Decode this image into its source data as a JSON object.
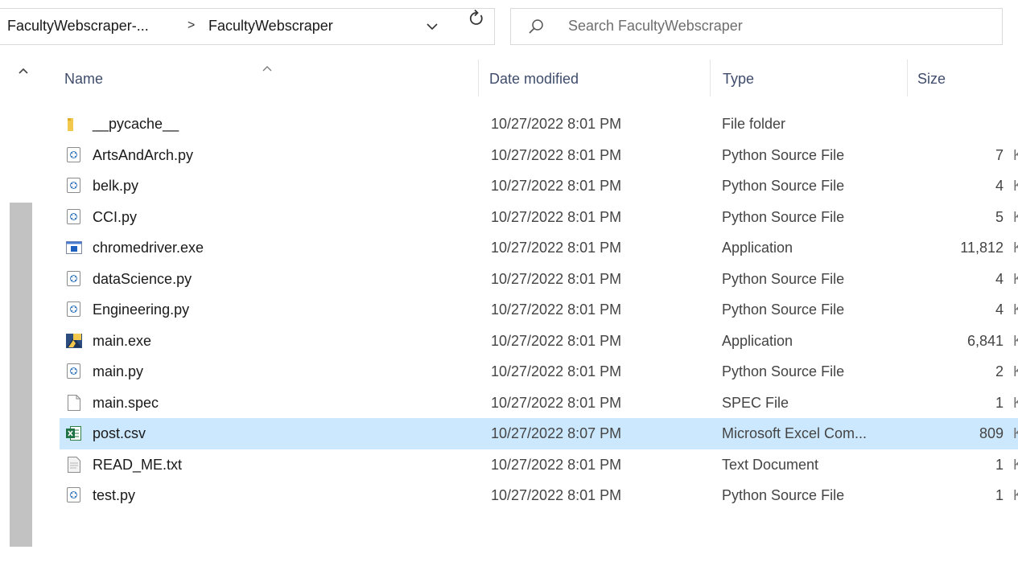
{
  "address": {
    "crumbs": [
      "FacultyWebscraper-...",
      "FacultyWebscraper"
    ],
    "separator": ">",
    "dropdown_icon": "chevron-down-icon",
    "refresh_icon": "refresh-icon"
  },
  "search": {
    "placeholder": "Search FacultyWebscraper",
    "icon": "search-icon"
  },
  "columns": {
    "name": "Name",
    "date": "Date modified",
    "type": "Type",
    "size": "Size"
  },
  "files": [
    {
      "name": "__pycache__",
      "date": "10/27/2022 8:01 PM",
      "type": "File folder",
      "size": "",
      "icon": "folder-icon"
    },
    {
      "name": "ArtsAndArch.py",
      "date": "10/27/2022 8:01 PM",
      "type": "Python Source File",
      "size": "7",
      "icon": "python-file-icon"
    },
    {
      "name": "belk.py",
      "date": "10/27/2022 8:01 PM",
      "type": "Python Source File",
      "size": "4",
      "icon": "python-file-icon"
    },
    {
      "name": "CCI.py",
      "date": "10/27/2022 8:01 PM",
      "type": "Python Source File",
      "size": "5",
      "icon": "python-file-icon"
    },
    {
      "name": "chromedriver.exe",
      "date": "10/27/2022 8:01 PM",
      "type": "Application",
      "size": "11,812",
      "icon": "application-icon"
    },
    {
      "name": "dataScience.py",
      "date": "10/27/2022 8:01 PM",
      "type": "Python Source File",
      "size": "4",
      "icon": "python-file-icon"
    },
    {
      "name": "Engineering.py",
      "date": "10/27/2022 8:01 PM",
      "type": "Python Source File",
      "size": "4",
      "icon": "python-file-icon"
    },
    {
      "name": "main.exe",
      "date": "10/27/2022 8:01 PM",
      "type": "Application",
      "size": "6,841",
      "icon": "pyinstaller-exe-icon"
    },
    {
      "name": "main.py",
      "date": "10/27/2022 8:01 PM",
      "type": "Python Source File",
      "size": "2",
      "icon": "python-file-icon"
    },
    {
      "name": "main.spec",
      "date": "10/27/2022 8:01 PM",
      "type": "SPEC File",
      "size": "1",
      "icon": "blank-file-icon"
    },
    {
      "name": "post.csv",
      "date": "10/27/2022 8:07 PM",
      "type": "Microsoft Excel Com...",
      "size": "809",
      "icon": "excel-csv-icon",
      "selected": true
    },
    {
      "name": "READ_ME.txt",
      "date": "10/27/2022 8:01 PM",
      "type": "Text Document",
      "size": "1",
      "icon": "text-file-icon"
    },
    {
      "name": "test.py",
      "date": "10/27/2022 8:01 PM",
      "type": "Python Source File",
      "size": "1",
      "icon": "python-file-icon"
    }
  ],
  "colors": {
    "selection": "#cce8ff",
    "header_text": "#3f4c6b",
    "scrollbar_thumb": "#c2c2c2"
  }
}
